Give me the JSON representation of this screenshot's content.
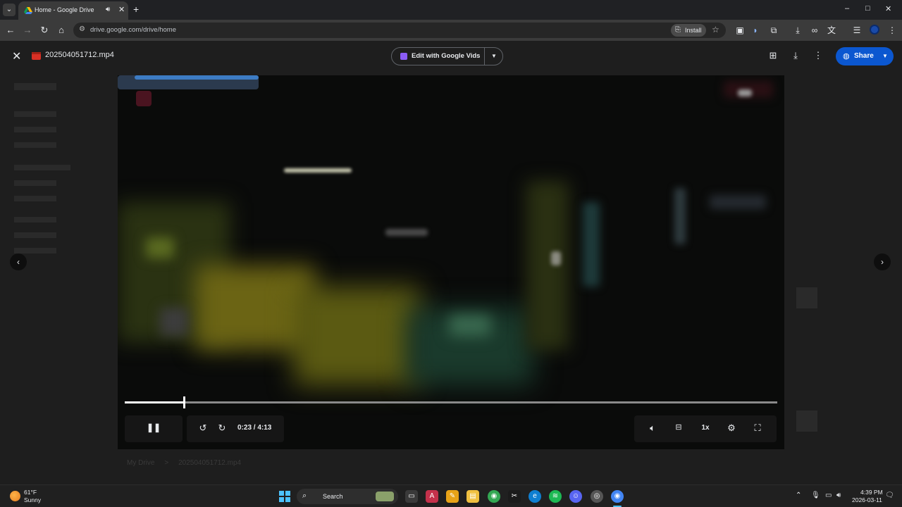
{
  "browser": {
    "tab_menu_icon": "chevron-down-icon",
    "tab_title": "Home - Google Drive",
    "new_tab_label": "+",
    "url": "drive.google.com/drive/home",
    "install_label": "Install",
    "window_controls": {
      "minimize": "–",
      "maximize": "□",
      "close": "✕"
    }
  },
  "viewer": {
    "file_name": "202504051712.mp4",
    "edit_label": "Edit with Google Vids",
    "share_label": "Share",
    "prev_icon": "chevron-left-icon",
    "next_icon": "chevron-right-icon"
  },
  "player": {
    "current_time": "0:23",
    "duration": " / 4:13",
    "progress_fraction": 0.0909,
    "speed_label": "1x",
    "state": "playing"
  },
  "background": {
    "breadcrumb": [
      "My Drive",
      ">",
      "202504051712.mp4"
    ]
  },
  "taskbar": {
    "temperature": "61°F",
    "condition": "Sunny",
    "search_label": "Search",
    "time": "4:39 PM",
    "date": "2026-03-11"
  },
  "colors": {
    "share_button": "#0b57d0",
    "vids_icon": "#8b5cf6",
    "file_icon": "#d93025",
    "windows_accent": "#4cc2ff"
  }
}
